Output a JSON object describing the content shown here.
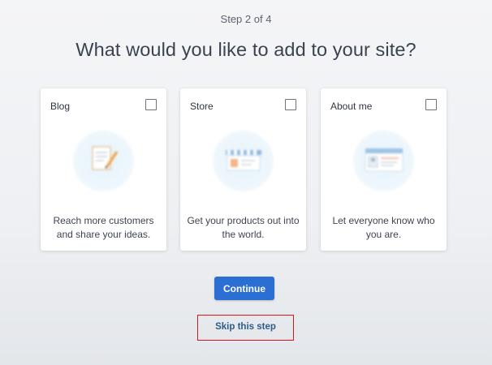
{
  "header": {
    "step": "Step 2 of 4",
    "title": "What would you like to add to your site?"
  },
  "cards": [
    {
      "label": "Blog",
      "description": "Reach more customers and share your ideas.",
      "icon": "blog-notepad-icon",
      "checked": false
    },
    {
      "label": "Store",
      "description": "Get your products out into the world.",
      "icon": "store-icon",
      "checked": false
    },
    {
      "label": "About me",
      "description": "Let everyone know who you are.",
      "icon": "profile-card-icon",
      "checked": false
    }
  ],
  "actions": {
    "continue_label": "Continue",
    "skip_label": "Skip this step"
  },
  "colors": {
    "primary_button": "#2a6fd1",
    "link": "#2c5c8f",
    "highlight_box": "#e01414"
  }
}
